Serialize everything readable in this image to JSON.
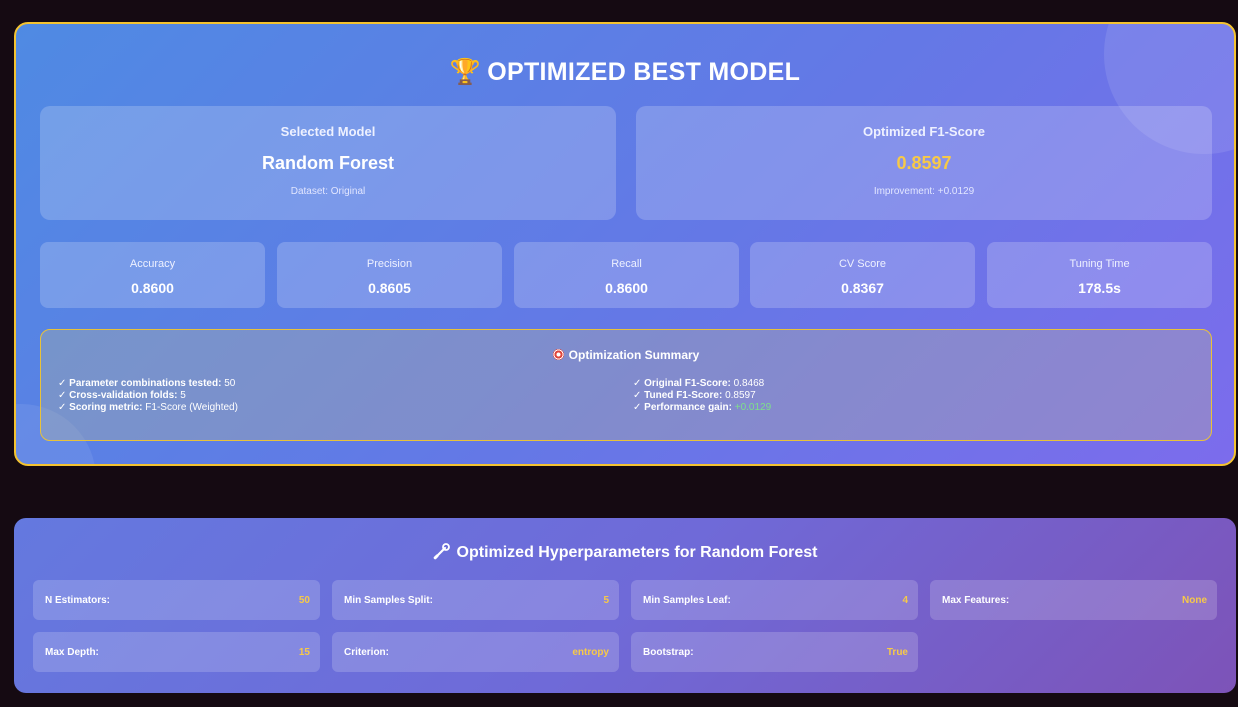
{
  "best_model": {
    "title": "OPTIMIZED BEST MODEL",
    "trophy_icon": "🏆",
    "selected": {
      "label": "Selected Model",
      "value": "Random Forest",
      "sub": "Dataset: Original"
    },
    "f1": {
      "label": "Optimized F1-Score",
      "value": "0.8597",
      "sub": "Improvement: +0.0129"
    },
    "metrics": [
      {
        "label": "Accuracy",
        "value": "0.8600"
      },
      {
        "label": "Precision",
        "value": "0.8605"
      },
      {
        "label": "Recall",
        "value": "0.8600"
      },
      {
        "label": "CV Score",
        "value": "0.8367"
      },
      {
        "label": "Tuning Time",
        "value": "178.5s"
      }
    ],
    "summary": {
      "title": "Optimization Summary",
      "left": [
        {
          "key": "✓ Parameter combinations tested:",
          "value": " 50"
        },
        {
          "key": "✓ Cross-validation folds:",
          "value": " 5"
        },
        {
          "key": "✓ Scoring metric:",
          "value": " F1-Score (Weighted)"
        }
      ],
      "right": [
        {
          "key": "✓ Original F1-Score:",
          "value": " 0.8468"
        },
        {
          "key": "✓ Tuned F1-Score:",
          "value": " 0.8597"
        },
        {
          "key": "✓ Performance gain:",
          "value": " +0.0129"
        }
      ]
    }
  },
  "hyperparams": {
    "title": "Optimized Hyperparameters for Random Forest",
    "items": [
      {
        "label": "N Estimators:",
        "value": "50"
      },
      {
        "label": "Min Samples Split:",
        "value": "5"
      },
      {
        "label": "Min Samples Leaf:",
        "value": "4"
      },
      {
        "label": "Max Features:",
        "value": "None"
      },
      {
        "label": "Max Depth:",
        "value": "15"
      },
      {
        "label": "Criterion:",
        "value": "entropy"
      },
      {
        "label": "Bootstrap:",
        "value": "True"
      }
    ]
  },
  "colors": {
    "accent_gold": "#f7c948",
    "gain_green": "#7ee08a",
    "border_gold": "#f3c331"
  }
}
